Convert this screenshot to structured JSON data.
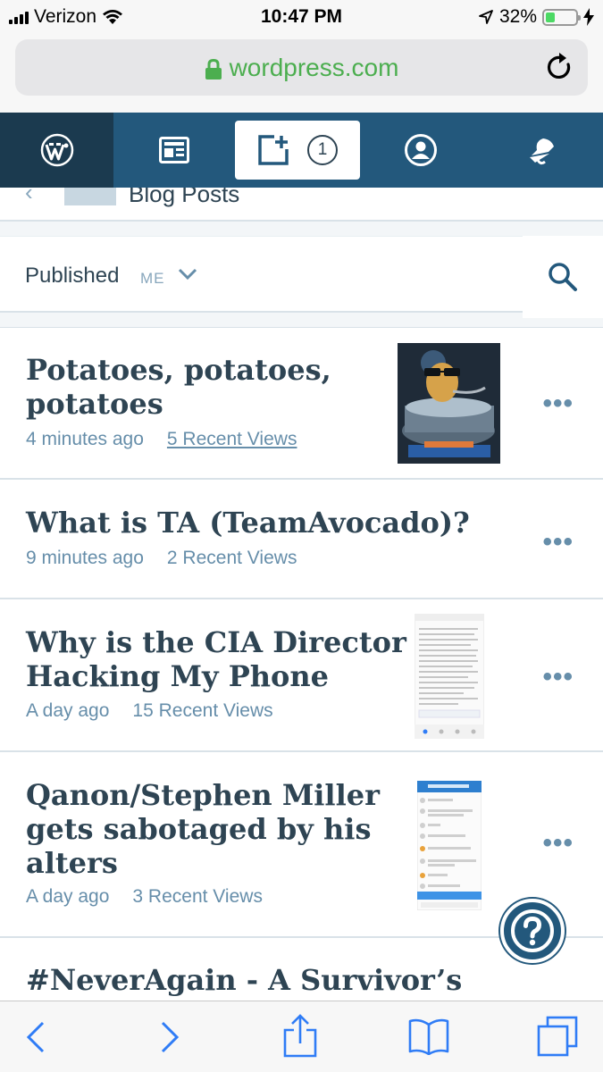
{
  "status_bar": {
    "carrier": "Verizon",
    "time": "10:47 PM",
    "battery": "32%",
    "battery_level": 0.32
  },
  "browser": {
    "host": "wordpress.com"
  },
  "nav": {
    "write_badge": "1"
  },
  "header": {
    "title": "Blog Posts"
  },
  "filter": {
    "status": "Published",
    "author": "ME"
  },
  "posts": [
    {
      "title": "Potatoes, potatoes, potatoes",
      "title_lines": [
        "Potatoes, potatoes,",
        "potatoes"
      ],
      "time": "4 minutes ago",
      "views": "5 Recent Views"
    },
    {
      "title": "What is TA (TeamAvocado)?",
      "title_lines": [
        "What is TA (TeamAvocado)?"
      ],
      "time": "9 minutes ago",
      "views": "2 Recent Views"
    },
    {
      "title": "Why is the CIA Director Hacking My Phone",
      "title_lines": [
        "Why is the CIA Director",
        "Hacking My Phone"
      ],
      "time": "A day ago",
      "views": "15 Recent Views"
    },
    {
      "title": "Qanon/Stephen Miller gets sabotaged by his alters",
      "title_lines": [
        "Qanon/Stephen Miller",
        "gets sabotaged by his",
        "alters"
      ],
      "time": "A day ago",
      "views": "3 Recent Views"
    },
    {
      "title": "#NeverAgain - A Survivor’s",
      "title_lines": [
        "#NeverAgain - A Survivor’s"
      ]
    }
  ],
  "more_label": "•••",
  "colors": {
    "nav_bg": "#23587c",
    "nav_active": "#1b3a4f",
    "link_green": "#4cae4f",
    "title": "#2e4453",
    "meta": "#668eaa",
    "ios_blue": "#2f7cf6"
  }
}
